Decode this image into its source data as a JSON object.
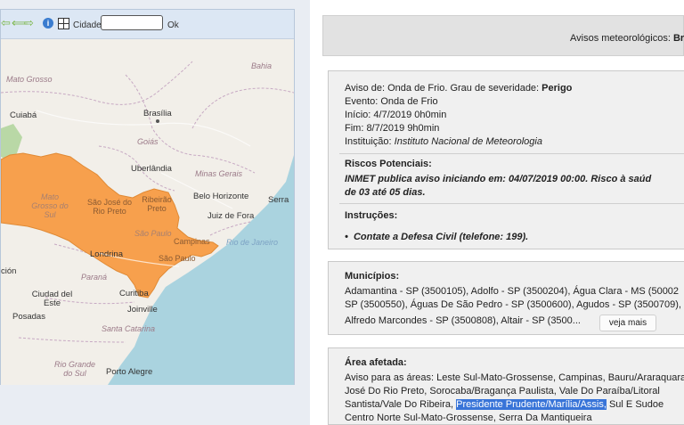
{
  "toolbar": {
    "city_label": "Cidade:",
    "city_value": "",
    "ok_label": "Ok"
  },
  "map": {
    "states": [
      "Mato Grosso",
      "Goiás",
      "Bahia",
      "Minas Gerais",
      "Mato Grosso do Sul",
      "Paraná",
      "Santa Catarina",
      "Rio Grande do Sul",
      "Rio de Janeiro",
      "São Paulo"
    ],
    "cities": [
      "Cuiabá",
      "Brasília",
      "Uberlândia",
      "Belo Horizonte",
      "Serra",
      "São José do Rio Preto",
      "Ribeirão Preto",
      "Juiz de Fora",
      "Campinas",
      "São Paulo",
      "Londrina",
      "Curitiba",
      "Joinville",
      "Ciudad del Este",
      "Posadas",
      "Porto Alegre",
      "ción"
    ],
    "alert_color": "#f7a04d"
  },
  "header": {
    "title_prefix": "Avisos meteorológicos:",
    "title_bold": "Br"
  },
  "aviso": {
    "aviso_label": "Aviso de:",
    "aviso_text": "Onda de Frio. Grau de severidade:",
    "severidade": "Perigo",
    "evento": "Evento: Onda de Frio",
    "inicio": "Início: 4/7/2019 0h0min",
    "fim": "Fim: 8/7/2019 9h0min",
    "instituicao_label": "Instituição:",
    "instituicao": "Instituto Nacional de Meteorologia",
    "riscos_title": "Riscos Potenciais:",
    "riscos_line1": "INMET publica aviso iniciando em: 04/07/2019 00:00. Risco à saúd",
    "riscos_line2": "de 03 até 05 dias.",
    "instrucoes_title": "Instruções:",
    "instrucao_1": "Contate a Defesa Civil (telefone: 199)."
  },
  "municipios": {
    "title": "Municípios:",
    "line1": "Adamantina - SP (3500105), Adolfo - SP (3500204), Água Clara - MS (50002",
    "line2": "SP (3500550), Águas De São Pedro - SP (3500600), Agudos - SP (3500709),",
    "line3": "Alfredo Marcondes - SP (3500808), Altair - SP (3500...",
    "button": "veja mais"
  },
  "area": {
    "title": "Área afetada:",
    "line1": "Aviso para as áreas: Leste Sul-Mato-Grossense, Campinas, Bauru/Araraquara",
    "line2": "José Do Rio Preto, Sorocaba/Bragança Paulista, Vale Do Paraíba/Litoral",
    "line3_a": "Santista/Vale Do Ribeira,",
    "line3_highlight": "Presidente Prudente/Marília/Assis,",
    "line3_b": "Sul E Sudoe",
    "line4": "Centro Norte Sul-Mato-Grossense, Serra Da Mantiqueira"
  }
}
